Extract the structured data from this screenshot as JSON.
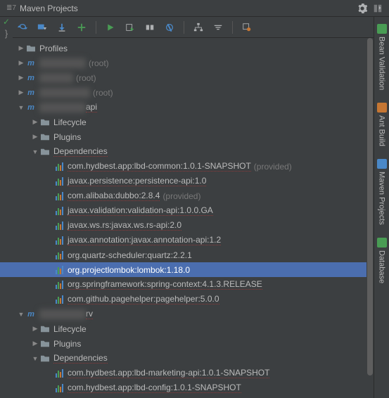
{
  "header": {
    "title": "Maven Projects",
    "left_icon_text": "7"
  },
  "side_tabs": [
    {
      "label": "Bean Validation",
      "icon": "bean-validation-icon",
      "color": "#499c54"
    },
    {
      "label": "Ant Build",
      "icon": "ant-icon",
      "color": "#c57633"
    },
    {
      "label": "Maven Projects",
      "icon": "maven-icon",
      "color": "#4a88c7"
    },
    {
      "label": "Database",
      "icon": "database-icon",
      "color": "#499c54"
    }
  ],
  "tree": [
    {
      "depth": 0,
      "arrow": "▶",
      "icon": "folder",
      "label": "Profiles"
    },
    {
      "depth": 0,
      "arrow": "▶",
      "icon": "m",
      "label_blur": "xxxxxxxxxxx",
      "suffix": "(root)"
    },
    {
      "depth": 0,
      "arrow": "▶",
      "icon": "m",
      "label_blur": "xxxxxxxx",
      "suffix": "(root)"
    },
    {
      "depth": 0,
      "arrow": "▶",
      "icon": "m",
      "label_blur": "xxxxxxxxxxxx",
      "suffix": "(root)"
    },
    {
      "depth": 0,
      "arrow": "▼",
      "icon": "m",
      "label_blur": "xxxxxxxxxxx",
      "label_tail": "api",
      "underline": true
    },
    {
      "depth": 1,
      "arrow": "▶",
      "icon": "folder",
      "label": "Lifecycle"
    },
    {
      "depth": 1,
      "arrow": "▶",
      "icon": "folder",
      "label": "Plugins"
    },
    {
      "depth": 1,
      "arrow": "▼",
      "icon": "folder",
      "label": "Dependencies",
      "underline": true
    },
    {
      "depth": 2,
      "arrow": "",
      "icon": "bars",
      "label": "com.hydbest.app:lbd-common:1.0.1-SNAPSHOT",
      "suffix": "(provided)",
      "underline": true
    },
    {
      "depth": 2,
      "arrow": "",
      "icon": "bars",
      "label": "javax.persistence:persistence-api:1.0",
      "underline": true
    },
    {
      "depth": 2,
      "arrow": "",
      "icon": "bars",
      "label": "com.alibaba:dubbo:2.8.4",
      "suffix": "(provided)",
      "underline": true
    },
    {
      "depth": 2,
      "arrow": "",
      "icon": "bars",
      "label": "javax.validation:validation-api:1.0.0.GA",
      "underline": true
    },
    {
      "depth": 2,
      "arrow": "",
      "icon": "bars",
      "label": "javax.ws.rs:javax.ws.rs-api:2.0",
      "underline": true
    },
    {
      "depth": 2,
      "arrow": "",
      "icon": "bars",
      "label": "javax.annotation:javax.annotation-api:1.2",
      "underline": true
    },
    {
      "depth": 2,
      "arrow": "",
      "icon": "bars",
      "label": "org.quartz-scheduler:quartz:2.2.1"
    },
    {
      "depth": 2,
      "arrow": "",
      "icon": "bars",
      "label": "org.projectlombok:lombok:1.18.0",
      "selected": true
    },
    {
      "depth": 2,
      "arrow": "",
      "icon": "bars",
      "label": "org.springframework:spring-context:4.1.3.RELEASE",
      "underline": true
    },
    {
      "depth": 2,
      "arrow": "",
      "icon": "bars",
      "label": "com.github.pagehelper:pagehelper:5.0.0",
      "underline": true
    },
    {
      "depth": 0,
      "arrow": "▼",
      "icon": "m",
      "label_blur": "xxxxxxxxxxx",
      "label_tail": "rv",
      "underline": true
    },
    {
      "depth": 1,
      "arrow": "▶",
      "icon": "folder",
      "label": "Lifecycle"
    },
    {
      "depth": 1,
      "arrow": "▶",
      "icon": "folder",
      "label": "Plugins"
    },
    {
      "depth": 1,
      "arrow": "▼",
      "icon": "folder",
      "label": "Dependencies",
      "underline": true
    },
    {
      "depth": 2,
      "arrow": "",
      "icon": "bars",
      "label": "com.hydbest.app:lbd-marketing-api:1.0.1-SNAPSHOT",
      "underline": true
    },
    {
      "depth": 2,
      "arrow": "",
      "icon": "bars",
      "label": "com.hydbest.app:lbd-config:1.0.1-SNAPSHOT",
      "underline": true
    }
  ]
}
